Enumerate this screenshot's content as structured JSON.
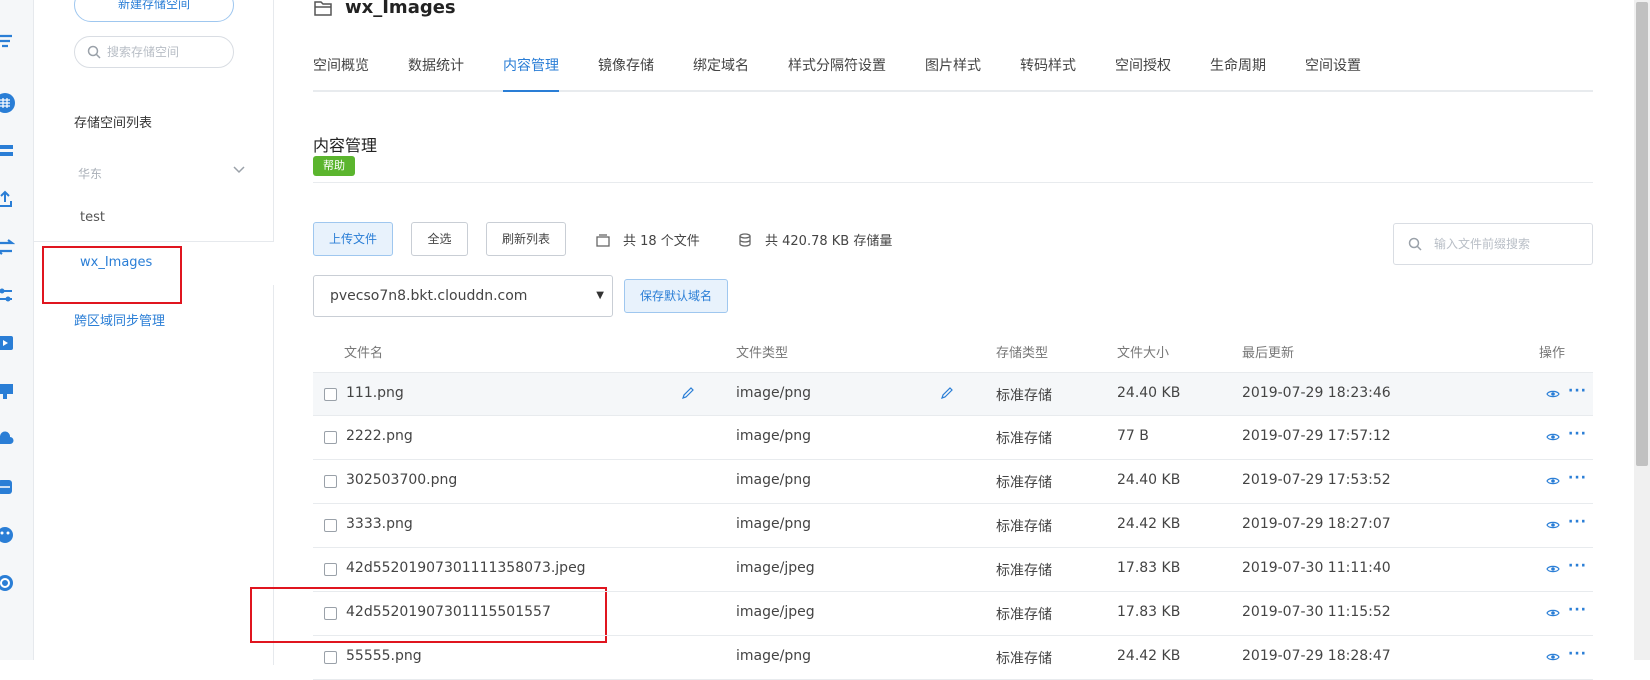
{
  "colors": {
    "accent": "#2a7ed6",
    "help_green": "#5bb52e",
    "annotation_red": "#e0151f"
  },
  "rail": {
    "icons": [
      "filter-icon",
      "grid-icon",
      "list-icon",
      "upload-icon",
      "transfer-icon",
      "sliders-icon",
      "video-icon",
      "monitor-icon",
      "cloud-icon",
      "storage-icon",
      "face-icon",
      "shield-icon"
    ]
  },
  "sidebar": {
    "new_bucket_label": "新建存储空间",
    "search_placeholder": "搜索存储空间",
    "list_title": "存储空间列表",
    "region": "华东",
    "buckets": [
      "test",
      "wx_Images"
    ],
    "cross_region_link": "跨区域同步管理"
  },
  "main": {
    "bucket_name": "wx_Images",
    "tabs": [
      "空间概览",
      "数据统计",
      "内容管理",
      "镜像存储",
      "绑定域名",
      "样式分隔符设置",
      "图片样式",
      "转码样式",
      "空间授权",
      "生命周期",
      "空间设置"
    ],
    "active_tab": "内容管理",
    "section_title": "内容管理",
    "help_label": "帮助",
    "toolbar": {
      "upload_label": "上传文件",
      "select_all_label": "全选",
      "refresh_label": "刷新列表",
      "file_count_text": "共 18 个文件",
      "storage_text": "共 420.78 KB 存储量",
      "search_placeholder": "输入文件前缀搜索"
    },
    "domain": {
      "selected": "pvecso7n8.bkt.clouddn.com",
      "save_label": "保存默认域名"
    },
    "table": {
      "headers": {
        "name": "文件名",
        "type": "文件类型",
        "storage": "存储类型",
        "size": "文件大小",
        "updated": "最后更新",
        "ops": "操作"
      },
      "rows": [
        {
          "name": "111.png",
          "type": "image/png",
          "storage": "标准存储",
          "size": "24.40 KB",
          "updated": "2019-07-29 18:23:46"
        },
        {
          "name": "2222.png",
          "type": "image/png",
          "storage": "标准存储",
          "size": "77 B",
          "updated": "2019-07-29 17:57:12"
        },
        {
          "name": "302503700.png",
          "type": "image/png",
          "storage": "标准存储",
          "size": "24.40 KB",
          "updated": "2019-07-29 17:53:52"
        },
        {
          "name": "3333.png",
          "type": "image/png",
          "storage": "标准存储",
          "size": "24.42 KB",
          "updated": "2019-07-29 18:27:07"
        },
        {
          "name": "42d55201907301111358073.jpeg",
          "type": "image/jpeg",
          "storage": "标准存储",
          "size": "17.83 KB",
          "updated": "2019-07-30 11:11:40"
        },
        {
          "name": "42d55201907301115501557",
          "type": "image/jpeg",
          "storage": "标准存储",
          "size": "17.83 KB",
          "updated": "2019-07-30 11:15:52"
        },
        {
          "name": "55555.png",
          "type": "image/png",
          "storage": "标准存储",
          "size": "24.42 KB",
          "updated": "2019-07-29 18:28:47"
        }
      ]
    }
  }
}
